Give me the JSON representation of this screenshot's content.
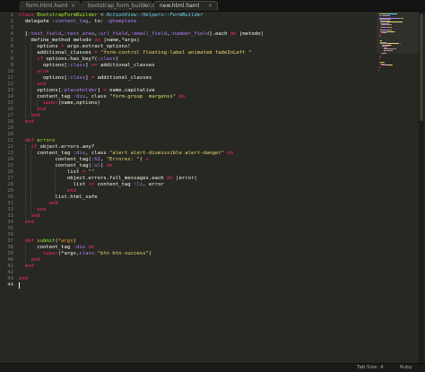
{
  "tabs": [
    {
      "label": "form.html.haml",
      "active": false
    },
    {
      "label": "bootstrap_form_builder.rb",
      "active": false
    },
    {
      "label": "new.html.haml",
      "active": true
    }
  ],
  "editor": {
    "current_line": 44,
    "lines": [
      {
        "n": 1,
        "tokens": [
          [
            "kw",
            "class "
          ],
          [
            "fn",
            "BootstrapFormBuilder"
          ],
          [
            "txt",
            " < "
          ],
          [
            "const",
            "ActionView::Helpers::FormBuilder"
          ]
        ]
      },
      {
        "n": 2,
        "tokens": [
          [
            "txt",
            "  delegate "
          ],
          [
            "sym",
            ":content_tag"
          ],
          [
            "txt",
            ", to: "
          ],
          [
            "sym",
            ":@template"
          ]
        ]
      },
      {
        "n": 3,
        "tokens": []
      },
      {
        "n": 4,
        "tokens": [
          [
            "txt",
            "  ["
          ],
          [
            "sym",
            ":text_field"
          ],
          [
            "txt",
            ","
          ],
          [
            "sym",
            ":text_area"
          ],
          [
            "txt",
            ","
          ],
          [
            "sym",
            ":url_field"
          ],
          [
            "txt",
            ","
          ],
          [
            "sym",
            ":email_field"
          ],
          [
            "txt",
            ","
          ],
          [
            "sym",
            ":number_field"
          ],
          [
            "txt",
            "].each "
          ],
          [
            "kw",
            "do"
          ],
          [
            "txt",
            " |metodo|"
          ]
        ]
      },
      {
        "n": 5,
        "tokens": [
          [
            "txt",
            "    define_method metodo "
          ],
          [
            "kw",
            "do"
          ],
          [
            "txt",
            " |name,*args|"
          ]
        ]
      },
      {
        "n": 6,
        "tokens": [
          [
            "txt",
            "      options "
          ],
          [
            "kw",
            "="
          ],
          [
            "txt",
            " args.extract_options!"
          ]
        ]
      },
      {
        "n": 7,
        "tokens": [
          [
            "txt",
            "      additional_classes "
          ],
          [
            "kw",
            "="
          ],
          [
            "str",
            " \"form-control floating-label animated fadeInLeft \""
          ]
        ]
      },
      {
        "n": 8,
        "tokens": [
          [
            "kw",
            "      if"
          ],
          [
            "txt",
            " options.has_key?("
          ],
          [
            "sym",
            ":class"
          ],
          [
            "txt",
            ")"
          ]
        ]
      },
      {
        "n": 9,
        "tokens": [
          [
            "txt",
            "        options["
          ],
          [
            "sym",
            ":class"
          ],
          [
            "txt",
            "] "
          ],
          [
            "kw",
            "+="
          ],
          [
            "txt",
            " additional_classes"
          ]
        ]
      },
      {
        "n": 10,
        "tokens": [
          [
            "kw",
            "      else"
          ]
        ]
      },
      {
        "n": 11,
        "tokens": [
          [
            "txt",
            "        options["
          ],
          [
            "sym",
            ":class"
          ],
          [
            "txt",
            "] "
          ],
          [
            "kw",
            "="
          ],
          [
            "txt",
            " additional_classes"
          ]
        ]
      },
      {
        "n": 12,
        "tokens": [
          [
            "kw",
            "      end"
          ]
        ]
      },
      {
        "n": 13,
        "tokens": [
          [
            "txt",
            "      options["
          ],
          [
            "sym",
            ":placeholder"
          ],
          [
            "txt",
            "] "
          ],
          [
            "kw",
            "="
          ],
          [
            "txt",
            " name.capitalize"
          ]
        ]
      },
      {
        "n": 14,
        "tokens": [
          [
            "txt",
            "      content_tag "
          ],
          [
            "sym",
            ":div"
          ],
          [
            "txt",
            ", class"
          ],
          [
            "kw",
            ":"
          ],
          [
            "str",
            "\"form-group  margenss\""
          ],
          [
            "kw",
            " do"
          ]
        ]
      },
      {
        "n": 15,
        "tokens": [
          [
            "kw",
            "        super"
          ],
          [
            "txt",
            "(name,options)"
          ]
        ]
      },
      {
        "n": 16,
        "tokens": [
          [
            "kw",
            "      end"
          ]
        ]
      },
      {
        "n": 17,
        "tokens": [
          [
            "kw",
            "    end"
          ]
        ]
      },
      {
        "n": 18,
        "tokens": [
          [
            "kw",
            "  end"
          ]
        ]
      },
      {
        "n": 19,
        "tokens": []
      },
      {
        "n": 20,
        "tokens": []
      },
      {
        "n": 21,
        "tokens": [
          [
            "kw",
            "  def "
          ],
          [
            "fn",
            "errors"
          ]
        ]
      },
      {
        "n": 22,
        "tokens": [
          [
            "kw",
            "    if"
          ],
          [
            "txt",
            " object.errors.any?"
          ]
        ]
      },
      {
        "n": 23,
        "tokens": [
          [
            "txt",
            "      content_tag "
          ],
          [
            "sym",
            ":div"
          ],
          [
            "txt",
            ", class"
          ],
          [
            "kw",
            ":"
          ],
          [
            "str",
            "\"alert alert-dismissible alert-danger\""
          ],
          [
            "kw",
            " do"
          ]
        ]
      },
      {
        "n": 24,
        "tokens": [
          [
            "txt",
            "            content_tag("
          ],
          [
            "sym",
            ":h2"
          ],
          [
            "txt",
            ", "
          ],
          [
            "str",
            "\"Errores: \""
          ],
          [
            "txt",
            ") "
          ],
          [
            "kw",
            "+"
          ]
        ]
      },
      {
        "n": 25,
        "tokens": [
          [
            "txt",
            "            content_tag("
          ],
          [
            "sym",
            ":ul"
          ],
          [
            "txt",
            ") "
          ],
          [
            "kw",
            "do"
          ]
        ]
      },
      {
        "n": 26,
        "tokens": [
          [
            "txt",
            "                list "
          ],
          [
            "kw",
            "="
          ],
          [
            "str",
            " \"\""
          ]
        ]
      },
      {
        "n": 27,
        "tokens": [
          [
            "txt",
            "                object.errors.full_messages.each "
          ],
          [
            "kw",
            "do"
          ],
          [
            "txt",
            " |error|"
          ]
        ]
      },
      {
        "n": 28,
        "tokens": [
          [
            "txt",
            "                  list "
          ],
          [
            "kw",
            "<<"
          ],
          [
            "txt",
            " content_tag "
          ],
          [
            "sym",
            ":li"
          ],
          [
            "txt",
            ", error"
          ]
        ]
      },
      {
        "n": 29,
        "tokens": [
          [
            "kw",
            "                end"
          ]
        ]
      },
      {
        "n": 30,
        "tokens": [
          [
            "txt",
            "            list.html_safe"
          ]
        ]
      },
      {
        "n": 31,
        "tokens": [
          [
            "kw",
            "          end"
          ]
        ]
      },
      {
        "n": 32,
        "tokens": [
          [
            "kw",
            "      end"
          ]
        ]
      },
      {
        "n": 33,
        "tokens": [
          [
            "kw",
            "    end"
          ]
        ]
      },
      {
        "n": 34,
        "tokens": [
          [
            "kw",
            "  end"
          ]
        ]
      },
      {
        "n": 35,
        "tokens": []
      },
      {
        "n": 36,
        "tokens": []
      },
      {
        "n": 37,
        "tokens": [
          [
            "kw",
            "  def "
          ],
          [
            "fn",
            "submit"
          ],
          [
            "txt",
            "("
          ],
          [
            "var",
            "*args"
          ],
          [
            "txt",
            ")"
          ]
        ]
      },
      {
        "n": 38,
        "tokens": [
          [
            "txt",
            "      content_tag "
          ],
          [
            "sym",
            ":div"
          ],
          [
            "kw",
            " do"
          ]
        ]
      },
      {
        "n": 39,
        "tokens": [
          [
            "kw",
            "        super"
          ],
          [
            "txt",
            "(*args,"
          ],
          [
            "sym",
            "class"
          ],
          [
            "kw",
            ":"
          ],
          [
            "str",
            "\"btn btn-success\""
          ],
          [
            "txt",
            ")"
          ]
        ]
      },
      {
        "n": 40,
        "tokens": [
          [
            "kw",
            "    end"
          ]
        ]
      },
      {
        "n": 41,
        "tokens": [
          [
            "kw",
            "  end"
          ]
        ]
      },
      {
        "n": 42,
        "tokens": []
      },
      {
        "n": 43,
        "tokens": [
          [
            "kw",
            "end"
          ]
        ]
      },
      {
        "n": 44,
        "tokens": []
      }
    ]
  },
  "statusbar": {
    "tab_size": "Tab Size: 4",
    "syntax": "Ruby"
  },
  "colors": {
    "background": "#272822",
    "keyword": "#f92672",
    "function": "#a6e22e",
    "constant": "#66d9ef",
    "string": "#e6db74",
    "symbol": "#ae81ff",
    "parameter": "#fd971f",
    "text": "#f8f8f2"
  }
}
